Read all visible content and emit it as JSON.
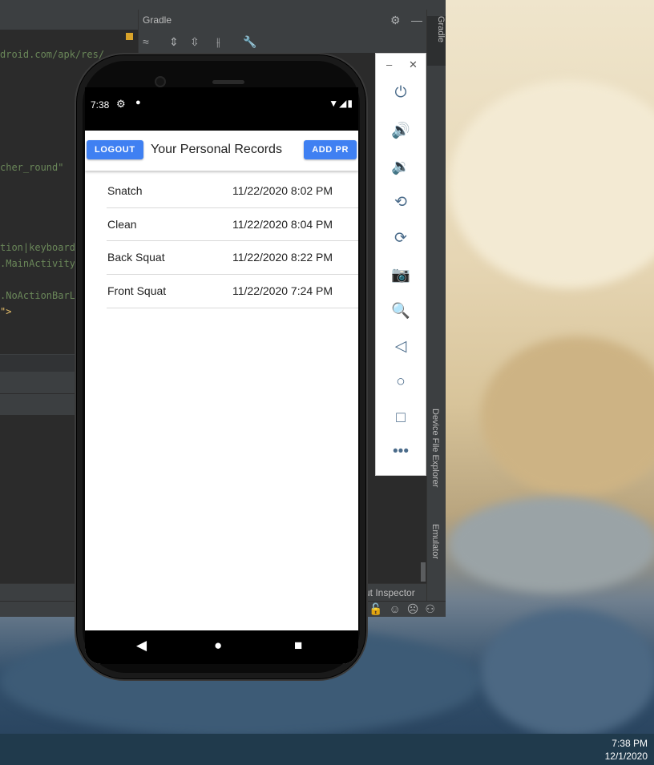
{
  "ide": {
    "gradle_panel_title": "Gradle",
    "code_lines": [
      {
        "text": "droid.com/apk/res/",
        "color": "#6a8759"
      },
      {
        "text": "cher_round\"",
        "color": "#6a8759"
      },
      {
        "text": "tion|keyboard",
        "color": "#6a8759"
      },
      {
        "text": ".MainActivity",
        "color": "#6a8759"
      },
      {
        "text": ".NoActionBarL",
        "color": "#6a8759"
      },
      {
        "text": "\">",
        "color": "#e8bf6a"
      }
    ],
    "right_tabs": {
      "gradle": "Gradle",
      "device_file_explorer": "Device File Explorer",
      "emulator": "Emulator"
    },
    "bottom_tool_label": "ut Inspector"
  },
  "phone": {
    "status_time": "7:38",
    "app_title": "Your Personal Records",
    "logout_label": "LOGOUT",
    "add_pr_label": "ADD PR",
    "accent_color": "#3f80f2",
    "records": [
      {
        "name": "Snatch",
        "date": "11/22/2020 8:02 PM"
      },
      {
        "name": "Clean",
        "date": "11/22/2020 8:04 PM"
      },
      {
        "name": "Back Squat",
        "date": "11/22/2020 8:22 PM"
      },
      {
        "name": "Front Squat",
        "date": "11/22/2020 7:24 PM"
      }
    ]
  },
  "emulator_controls": [
    "power-icon",
    "volume-up-icon",
    "volume-down-icon",
    "rotate-left-icon",
    "rotate-right-icon",
    "camera-icon",
    "zoom-icon",
    "back-icon",
    "home-icon",
    "overview-icon",
    "more-icon"
  ],
  "taskbar": {
    "time": "7:38 PM",
    "date": "12/1/2020"
  }
}
